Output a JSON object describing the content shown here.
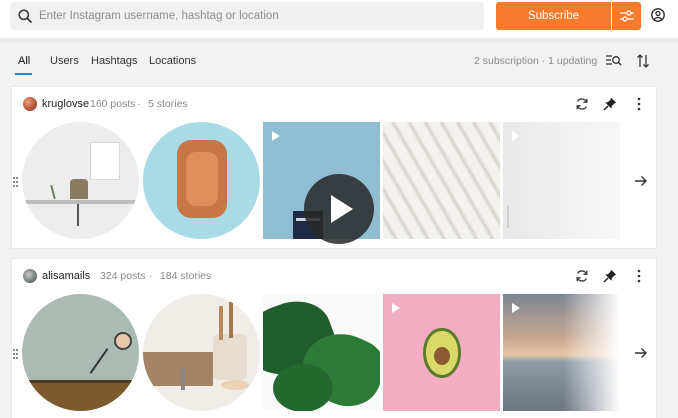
{
  "search": {
    "placeholder": "Enter Instagram username, hashtag or location"
  },
  "toolbar": {
    "subscribe_label": "Subscribe"
  },
  "tabs": [
    {
      "label": "All",
      "active": true
    },
    {
      "label": "Users"
    },
    {
      "label": "Hashtags"
    },
    {
      "label": "Locations"
    }
  ],
  "status": "2 subscription · 1 updating",
  "accent_color": "#f57a2b",
  "tab_underline_color": "#1e8ad9",
  "feeds": [
    {
      "username": "kruglovse",
      "posts": "160 posts",
      "separator": "·",
      "stories": "5 stories",
      "media": [
        {
          "kind": "story",
          "subject": "desk with chair and plant"
        },
        {
          "kind": "story",
          "subject": "terracotta dish on blue"
        },
        {
          "kind": "video",
          "subject": "building under blue sky"
        },
        {
          "kind": "photo",
          "subject": "white sand ripples"
        },
        {
          "kind": "video",
          "subject": "white wall"
        }
      ]
    },
    {
      "username": "alisamails",
      "posts": "324 posts",
      "separator": "·",
      "stories": "184 stories",
      "media": [
        {
          "kind": "story",
          "subject": "wall lamp"
        },
        {
          "kind": "story",
          "subject": "kitchen utensils"
        },
        {
          "kind": "photo",
          "subject": "monstera leaves"
        },
        {
          "kind": "video",
          "subject": "avocado on pink"
        },
        {
          "kind": "video",
          "subject": "sunset beach"
        }
      ]
    }
  ],
  "icons": [
    "search-icon",
    "filters-icon",
    "account-icon",
    "list-search-icon",
    "sort-icon",
    "refresh-icon",
    "pin-icon",
    "more-vertical-icon",
    "arrow-right-icon",
    "drag-handle-icon",
    "play-icon"
  ]
}
